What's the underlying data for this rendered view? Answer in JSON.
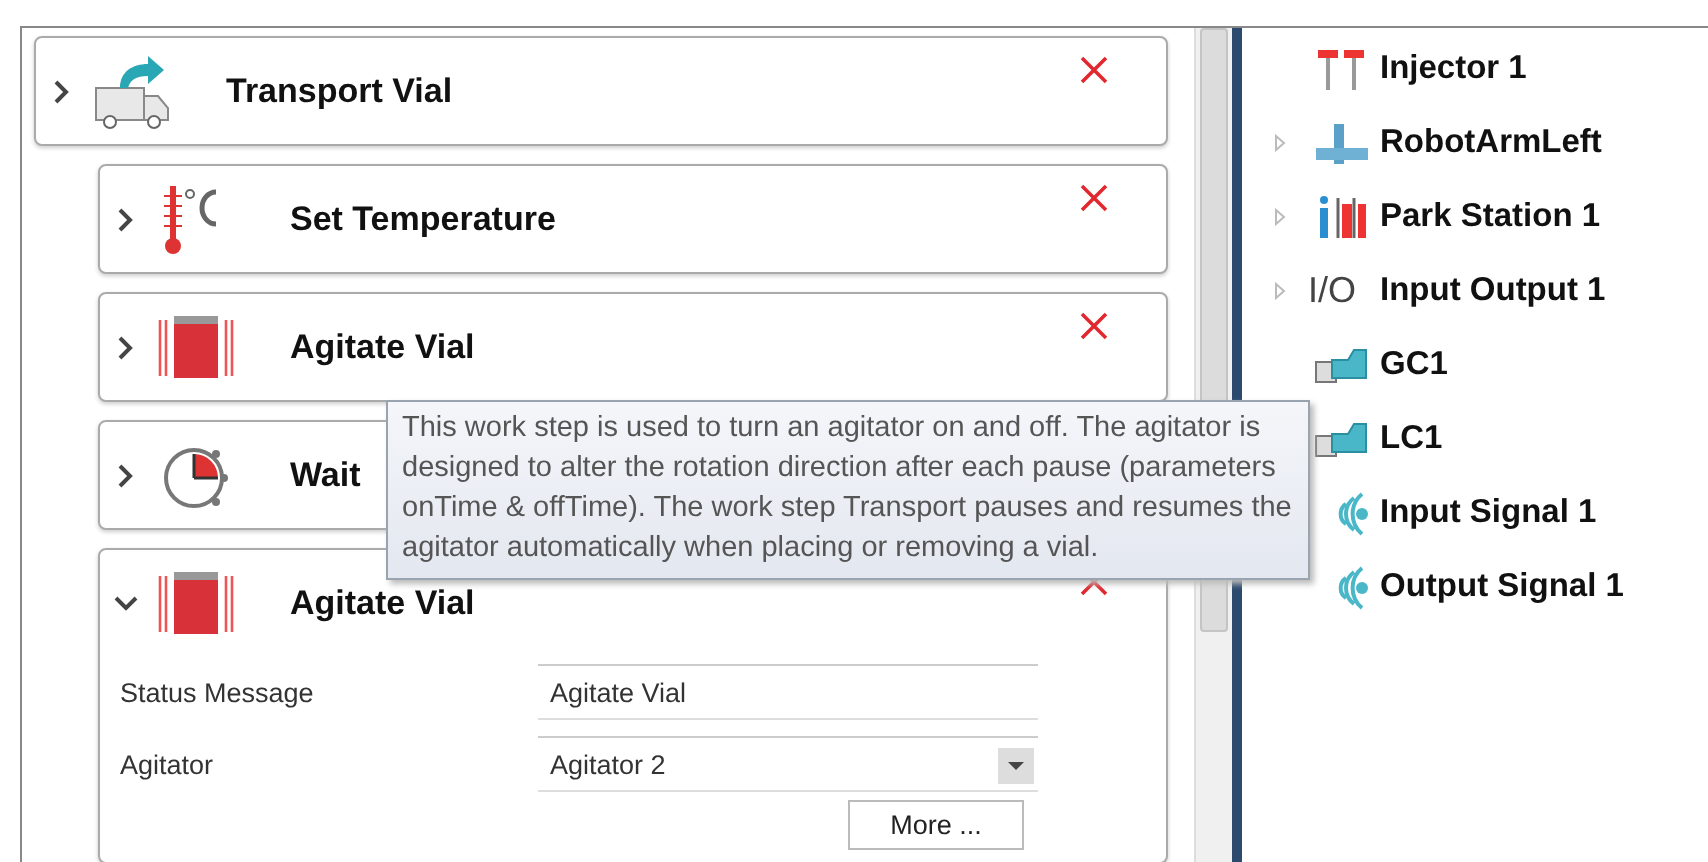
{
  "steps": [
    {
      "title": "Transport Vial",
      "kind": "truck",
      "expanded": false,
      "close_button": true,
      "children": [
        {
          "title": "Set Temperature",
          "kind": "thermometer",
          "expanded": false,
          "close_button": true
        },
        {
          "title": "Agitate Vial",
          "kind": "agitator",
          "expanded": false,
          "close_button": true
        },
        {
          "title": "Wait",
          "kind": "timer",
          "expanded": false,
          "close_button": false
        },
        {
          "title": "Agitate Vial",
          "kind": "agitator",
          "expanded": true,
          "close_button": true,
          "fields": [
            {
              "label": "Status Message",
              "kind": "text",
              "value": "Agitate Vial"
            },
            {
              "label": "Agitator",
              "kind": "dropdown",
              "value": "Agitator 2"
            }
          ],
          "button": "More ..."
        }
      ]
    }
  ],
  "tooltip": "This work step is used to turn an agitator on and off. The agitator is designed to alter the rotation direction after each pause (parameters onTime & offTime). The work step Transport pauses and resumes the agitator automatically when placing or removing a vial.",
  "tree": [
    {
      "label": "Injector 1",
      "kind": "injector",
      "expandable": false
    },
    {
      "label": "RobotArmLeft",
      "kind": "robot-arm",
      "expandable": true
    },
    {
      "label": "Park Station 1",
      "kind": "park-station",
      "expandable": true
    },
    {
      "label": "Input Output 1",
      "kind": "io",
      "icon_text": "I/O",
      "expandable": true
    },
    {
      "label": "GC1",
      "kind": "instrument",
      "expandable": false
    },
    {
      "label": "LC1",
      "kind": "instrument",
      "expandable": false
    },
    {
      "label": "Input Signal 1",
      "kind": "signal",
      "expandable": false
    },
    {
      "label": "Output Signal 1",
      "kind": "signal",
      "expandable": false
    }
  ]
}
